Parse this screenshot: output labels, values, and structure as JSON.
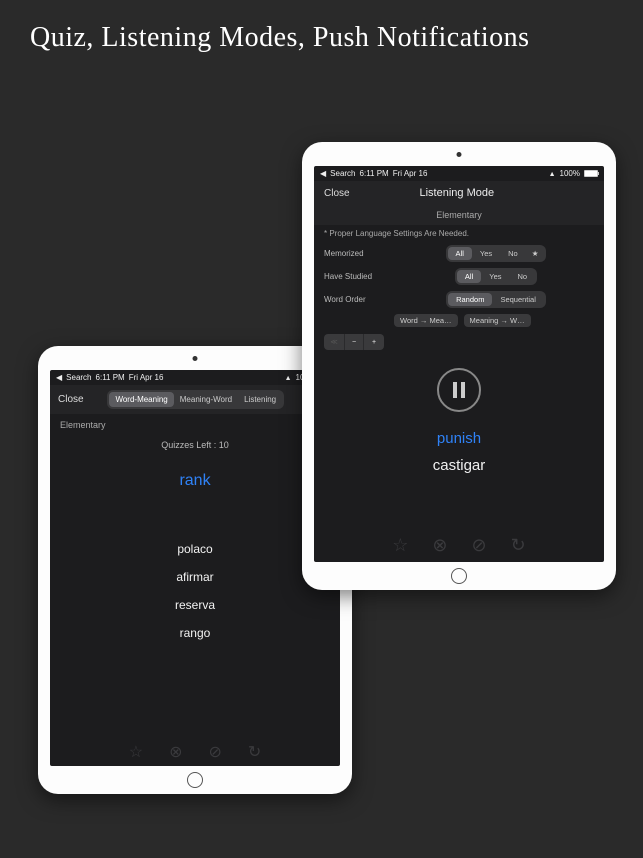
{
  "hero_title": "Quiz, Listening Modes, Push Notifications",
  "statusbar": {
    "back_label": "Search",
    "time": "6:11 PM",
    "date": "Fri Apr 16",
    "battery_pct": "100%"
  },
  "quiz": {
    "close_label": "Close",
    "tabs": {
      "word_meaning": "Word-Meaning",
      "meaning_word": "Meaning-Word",
      "listening": "Listening"
    },
    "level_label": "Elementary",
    "count_label": "Quizzes Left : 10",
    "word": "rank",
    "options": [
      "polaco",
      "afirmar",
      "reserva",
      "rango"
    ]
  },
  "listen": {
    "close_label": "Close",
    "title": "Listening Mode",
    "level_label": "Elementary",
    "notice": "* Proper Language Settings Are Needed.",
    "rows": {
      "memorized": "Memorized",
      "studied": "Have Studied",
      "order": "Word Order"
    },
    "segments": {
      "all": "All",
      "yes": "Yes",
      "no": "No",
      "random": "Random",
      "sequential": "Sequential"
    },
    "pills": {
      "a": "Word → Mea…",
      "b": "Meaning → W…"
    },
    "stepper": {
      "minus": "−",
      "plus": "+"
    },
    "word": "punish",
    "meaning": "castigar"
  }
}
